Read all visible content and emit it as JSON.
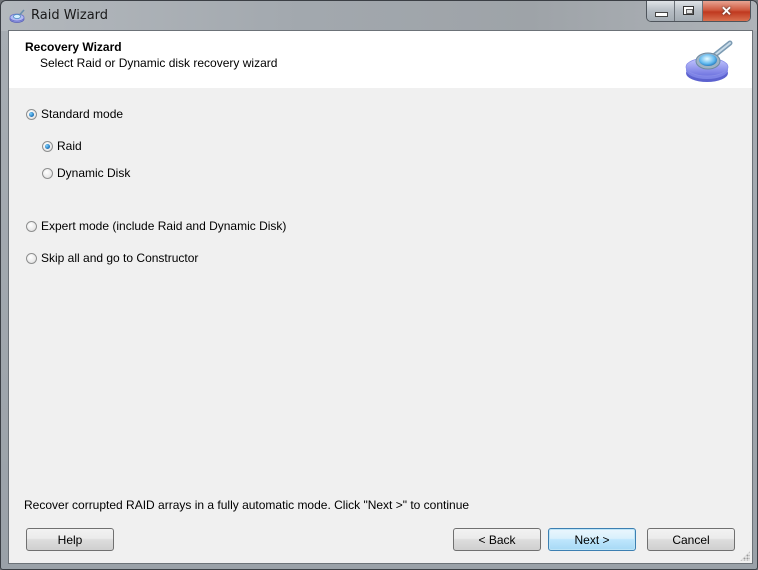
{
  "window": {
    "title": "Raid Wizard",
    "icon": "disk-search-icon",
    "caption_buttons": [
      "minimize",
      "maximize",
      "close"
    ]
  },
  "header": {
    "title": "Recovery Wizard",
    "subtitle": "Select Raid or Dynamic disk recovery wizard",
    "icon": "disk-magnifier-icon"
  },
  "options": {
    "standard_mode": {
      "label": "Standard mode",
      "checked": true
    },
    "raid": {
      "label": "Raid",
      "checked": true
    },
    "dynamic_disk": {
      "label": "Dynamic Disk",
      "checked": false
    },
    "expert_mode": {
      "label": "Expert mode (include Raid and Dynamic Disk)",
      "checked": false
    },
    "skip_all": {
      "label": "Skip all and go to Constructor",
      "checked": false
    }
  },
  "status_text": "Recover corrupted RAID arrays in a fully automatic mode. Click \"Next >\" to continue",
  "buttons": {
    "help": "Help",
    "back": "< Back",
    "next": "Next >",
    "cancel": "Cancel"
  },
  "colors": {
    "accent": "#3c7fb1",
    "close_button": "#c7422a",
    "client_bg": "#f0f0f0",
    "header_bg": "#ffffff"
  }
}
